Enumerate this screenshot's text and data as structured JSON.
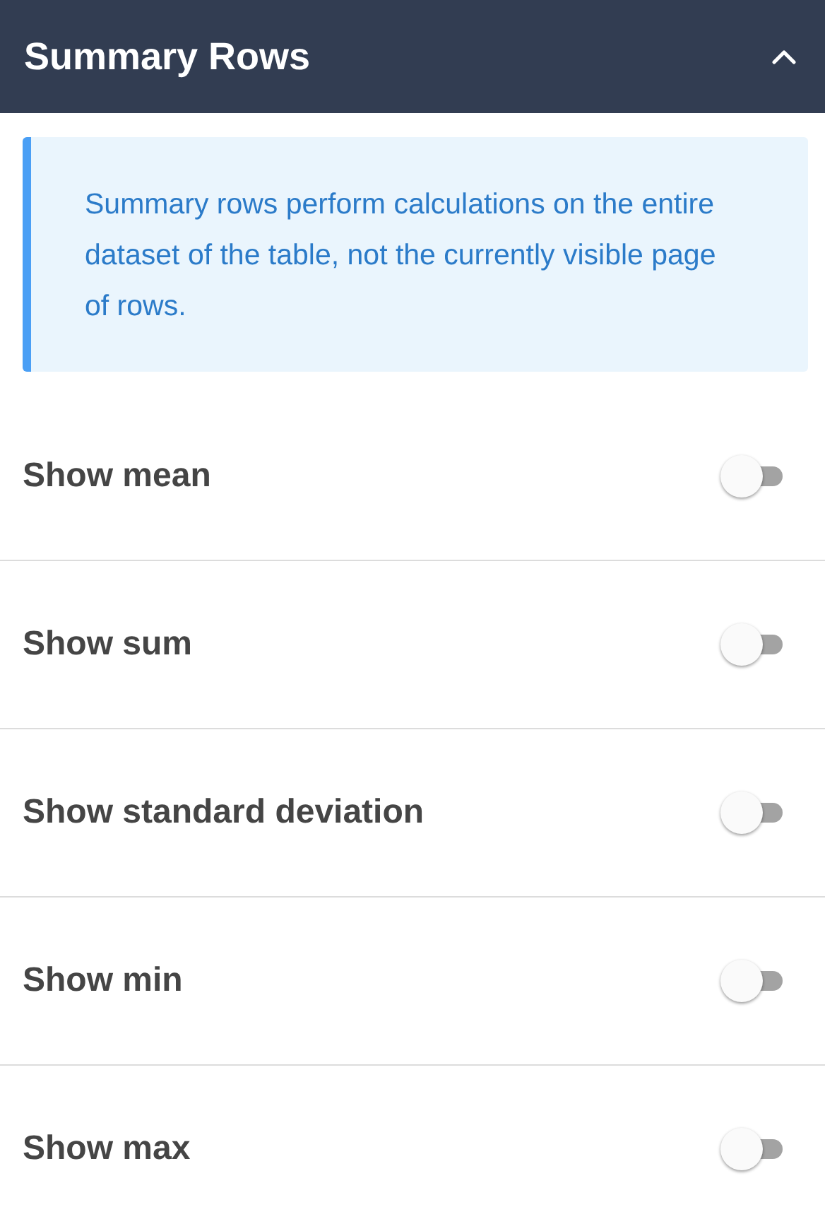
{
  "panel": {
    "title": "Summary Rows",
    "expanded": true
  },
  "info": "Summary rows perform calculations on the entire dataset of the table, not the currently visible page of rows.",
  "options": [
    {
      "label": "Show mean",
      "on": false
    },
    {
      "label": "Show sum",
      "on": false
    },
    {
      "label": "Show standard deviation",
      "on": false
    },
    {
      "label": "Show min",
      "on": false
    },
    {
      "label": "Show max",
      "on": false
    }
  ]
}
